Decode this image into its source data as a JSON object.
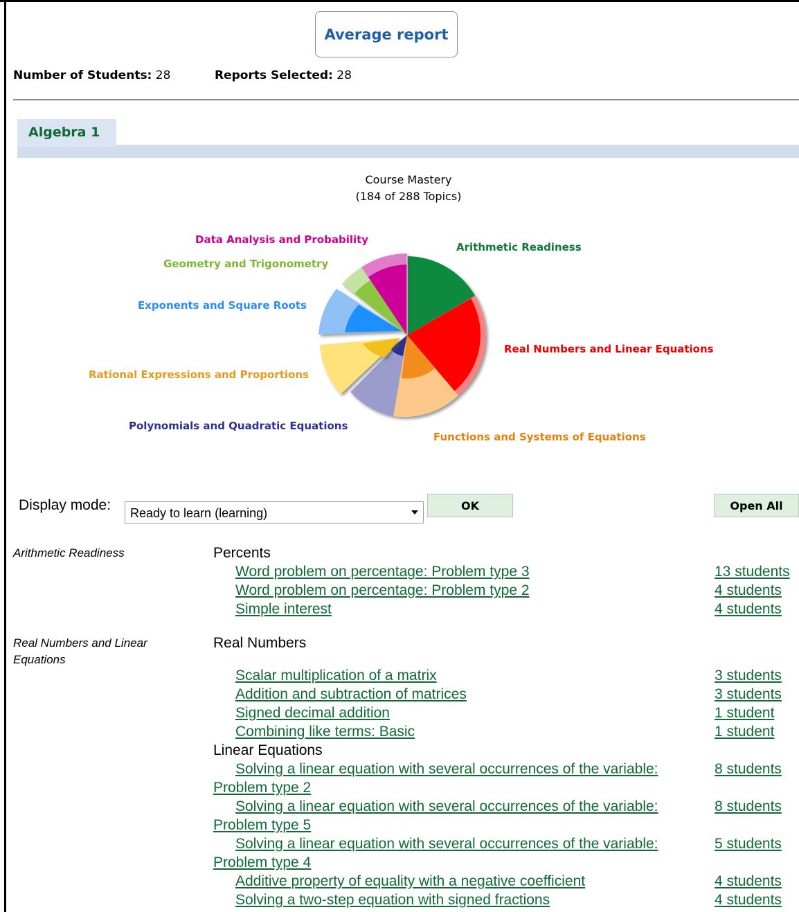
{
  "header": {
    "report_button": "Average report",
    "students_label": "Number of Students:",
    "students_value": "28",
    "reports_label": "Reports Selected:",
    "reports_value": "28"
  },
  "tab": {
    "label": "Algebra 1"
  },
  "chart": {
    "title": "Course Mastery",
    "subtitle": "(184 of 288 Topics)"
  },
  "chart_data": {
    "type": "pie",
    "title": "Course Mastery",
    "subtitle": "(184 of 288 Topics)",
    "slices": [
      {
        "name": "Arithmetic Readiness",
        "color": "#0f8a3c"
      },
      {
        "name": "Real Numbers and Linear Equations",
        "color": "#ff0000"
      },
      {
        "name": "Functions and Systems of Equations",
        "color": "#f28c1e"
      },
      {
        "name": "Polynomials and Quadratic Equations",
        "color": "#2e2f8e"
      },
      {
        "name": "Rational Expressions and Proportions",
        "color": "#f2c01e"
      },
      {
        "name": "Exponents and Square Roots",
        "color": "#1e90ff"
      },
      {
        "name": "Geometry and Trigonometry",
        "color": "#8cc63f"
      },
      {
        "name": "Data Analysis and Probability",
        "color": "#cc0099"
      }
    ]
  },
  "display_mode": {
    "label": "Display mode:",
    "value": "Ready to learn (learning)",
    "ok": "OK",
    "open_all": "Open All"
  },
  "sections": [
    {
      "category": "Arithmetic Readiness",
      "groups": [
        {
          "name": "Percents",
          "items": [
            {
              "title": "Word problem on percentage: Problem type 3",
              "students": "13 students"
            },
            {
              "title": "Word problem on percentage: Problem type 2",
              "students": "4 students"
            },
            {
              "title": "Simple interest",
              "students": "4 students"
            }
          ]
        }
      ]
    },
    {
      "category": "Real Numbers and Linear Equations",
      "groups": [
        {
          "name": "Real Numbers",
          "items": [
            {
              "title": "Scalar multiplication of a matrix",
              "students": "3 students"
            },
            {
              "title": "Addition and subtraction of matrices",
              "students": "3 students"
            },
            {
              "title": "Signed decimal addition",
              "students": "1 student"
            },
            {
              "title": "Combining like terms: Basic",
              "students": "1 student"
            }
          ]
        },
        {
          "name": "Linear Equations",
          "items": [
            {
              "title": "Solving a linear equation with several occurrences of the variable:",
              "title2": "Problem type 2",
              "students": "8 students"
            },
            {
              "title": "Solving a linear equation with several occurrences of the variable:",
              "title2": "Problem type 5",
              "students": "8 students"
            },
            {
              "title": "Solving a linear equation with several occurrences of the variable:",
              "title2": "Problem type 4",
              "students": "5 students"
            },
            {
              "title": "Additive property of equality with a negative coefficient",
              "students": "4 students"
            },
            {
              "title": "Solving a two-step equation with signed fractions",
              "students": "4 students"
            }
          ]
        }
      ]
    }
  ]
}
